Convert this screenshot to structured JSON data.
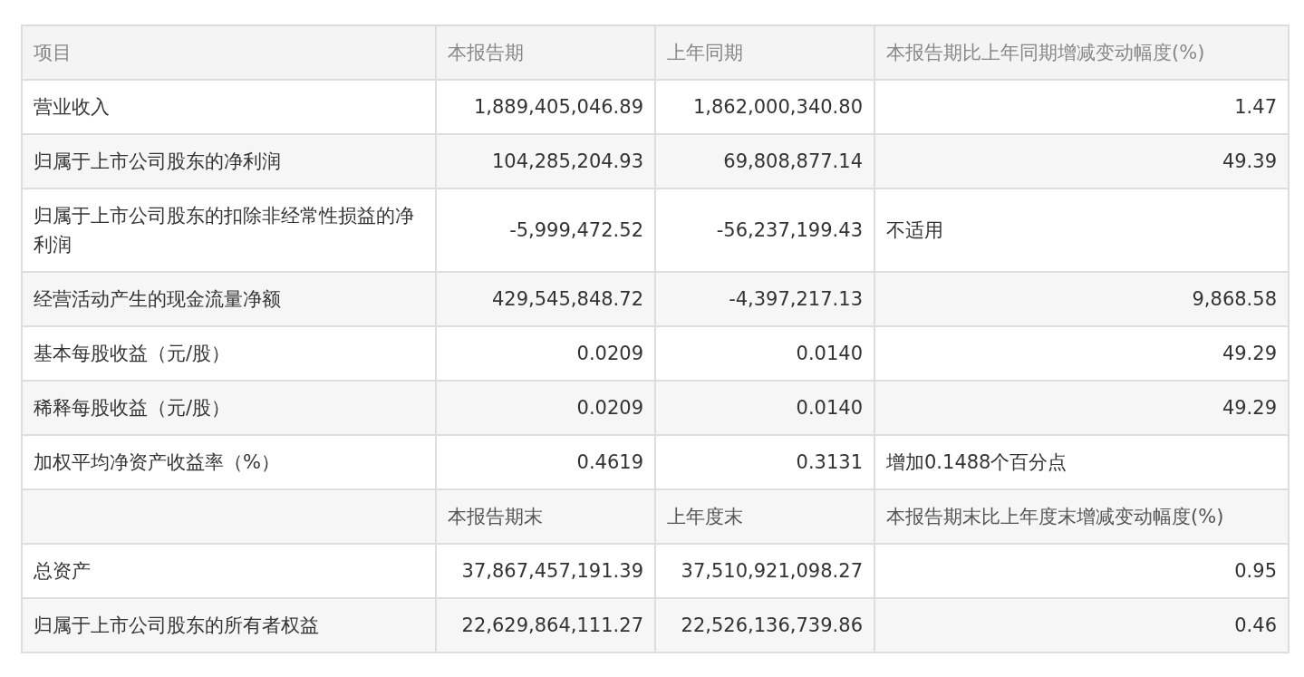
{
  "table": {
    "columns": [
      "项目",
      "本报告期",
      "上年同期",
      "本报告期比上年同期增减变动幅度(%)"
    ],
    "rows": [
      {
        "kind": "data",
        "cells": [
          {
            "text": "营业收入",
            "kind": "label"
          },
          {
            "text": "1,889,405,046.89",
            "kind": "number"
          },
          {
            "text": "1,862,000,340.80",
            "kind": "number"
          },
          {
            "text": "1.47",
            "kind": "number"
          }
        ]
      },
      {
        "kind": "data",
        "cells": [
          {
            "text": "归属于上市公司股东的净利润",
            "kind": "label"
          },
          {
            "text": "104,285,204.93",
            "kind": "number"
          },
          {
            "text": "69,808,877.14",
            "kind": "number"
          },
          {
            "text": "49.39",
            "kind": "number"
          }
        ]
      },
      {
        "kind": "data",
        "cells": [
          {
            "text": "归属于上市公司股东的扣除非经常性损益的净利润",
            "kind": "label"
          },
          {
            "text": "-5,999,472.52",
            "kind": "number"
          },
          {
            "text": "-56,237,199.43",
            "kind": "number"
          },
          {
            "text": "不适用",
            "kind": "label"
          }
        ]
      },
      {
        "kind": "data",
        "cells": [
          {
            "text": "经营活动产生的现金流量净额",
            "kind": "label"
          },
          {
            "text": "429,545,848.72",
            "kind": "number"
          },
          {
            "text": "-4,397,217.13",
            "kind": "number"
          },
          {
            "text": "9,868.58",
            "kind": "number"
          }
        ]
      },
      {
        "kind": "data",
        "cells": [
          {
            "text": "基本每股收益（元/股）",
            "kind": "label"
          },
          {
            "text": "0.0209",
            "kind": "number"
          },
          {
            "text": "0.0140",
            "kind": "number"
          },
          {
            "text": "49.29",
            "kind": "number"
          }
        ]
      },
      {
        "kind": "data",
        "cells": [
          {
            "text": "稀释每股收益（元/股）",
            "kind": "label"
          },
          {
            "text": "0.0209",
            "kind": "number"
          },
          {
            "text": "0.0140",
            "kind": "number"
          },
          {
            "text": "49.29",
            "kind": "number"
          }
        ]
      },
      {
        "kind": "data",
        "cells": [
          {
            "text": "加权平均净资产收益率（%）",
            "kind": "label"
          },
          {
            "text": "0.4619",
            "kind": "number"
          },
          {
            "text": "0.3131",
            "kind": "number"
          },
          {
            "text": "增加0.1488个百分点",
            "kind": "label"
          }
        ]
      },
      {
        "kind": "subheader",
        "cells": [
          {
            "text": "",
            "kind": "label"
          },
          {
            "text": "本报告期末",
            "kind": "label"
          },
          {
            "text": "上年度末",
            "kind": "label"
          },
          {
            "text": "本报告期末比上年度末增减变动幅度(%)",
            "kind": "label"
          }
        ]
      },
      {
        "kind": "data",
        "cells": [
          {
            "text": "总资产",
            "kind": "label"
          },
          {
            "text": "37,867,457,191.39",
            "kind": "number"
          },
          {
            "text": "37,510,921,098.27",
            "kind": "number"
          },
          {
            "text": "0.95",
            "kind": "number"
          }
        ]
      },
      {
        "kind": "data",
        "cells": [
          {
            "text": "归属于上市公司股东的所有者权益",
            "kind": "label"
          },
          {
            "text": "22,629,864,111.27",
            "kind": "number"
          },
          {
            "text": "22,526,136,739.86",
            "kind": "number"
          },
          {
            "text": "0.46",
            "kind": "number"
          }
        ]
      }
    ]
  }
}
